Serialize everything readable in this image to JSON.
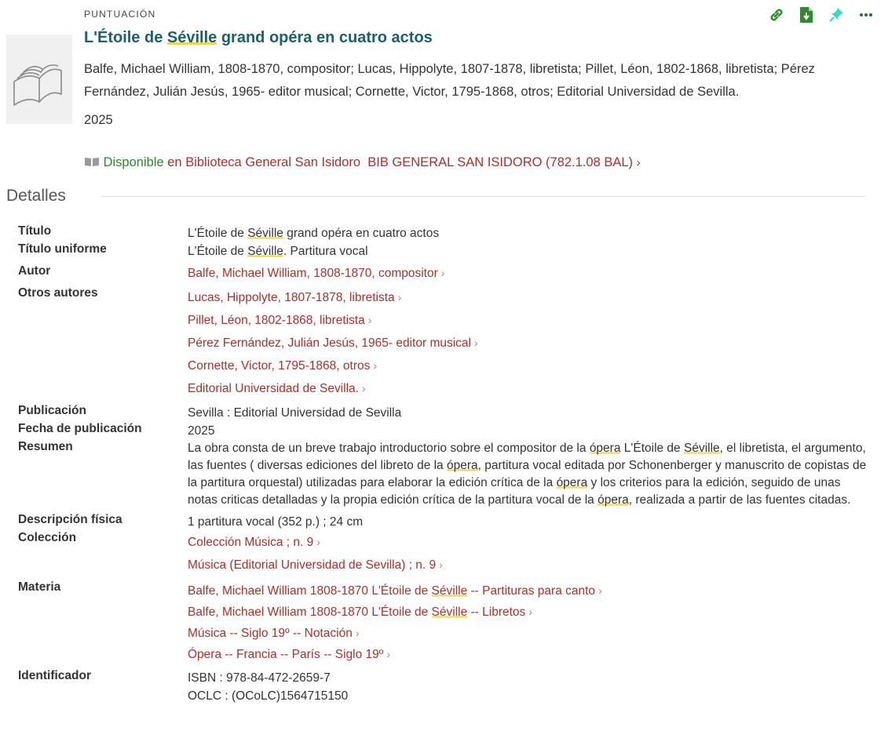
{
  "record": {
    "type": "PUNTUACIÓN",
    "title_pre": "L'Étoile de ",
    "title_hl": "Séville",
    "title_post": " grand opéra en cuatro actos",
    "authors_line": "Balfe, Michael William, 1808-1870, compositor; Lucas, Hippolyte, 1807-1878, libretista; Pillet, Léon, 1802-1868, libretista; Pérez Fernández, Julián Jesús, 1965- editor musical; Cornette, Victor, 1795-1868, otros; Editorial Universidad de Sevilla.",
    "year": "2025",
    "availability": {
      "status": "Disponible",
      "en": "en",
      "library": "Biblioteca General San Isidoro",
      "shelf": "BIB GENERAL SAN ISIDORO (782.1.08 BAL)"
    }
  },
  "actions": [
    "link-icon",
    "citation-export-icon",
    "pin-icon",
    "more-icon"
  ],
  "details": {
    "heading": "Detalles",
    "labels": {
      "titulo": "Título",
      "titulo_uniforme": "Título uniforme",
      "autor": "Autor",
      "otros_autores": "Otros autores",
      "publicacion": "Publicación",
      "fecha": "Fecha de publicación",
      "resumen": "Resumen",
      "descripcion": "Descripción física",
      "coleccion": "Colección",
      "materia": "Materia",
      "identificador": "Identificador"
    },
    "titulo": {
      "pre": "L'Étoile de ",
      "hl": "Séville",
      "post": " grand opéra en cuatro actos"
    },
    "titulo_uniforme": {
      "pre": "L'Étoile de ",
      "hl": "Séville",
      "post": ". Partitura vocal"
    },
    "autor": "Balfe, Michael William, 1808-1870, compositor",
    "otros_autores": [
      "Lucas, Hippolyte, 1807-1878, libretista",
      "Pillet, Léon, 1802-1868, libretista",
      "Pérez Fernández, Julián Jesús, 1965- editor musical",
      "Cornette, Victor, 1795-1868, otros",
      "Editorial Universidad de Sevilla."
    ],
    "publicacion": "Sevilla : Editorial Universidad de Sevilla",
    "fecha": "2025",
    "resumen": {
      "p1": "La obra consta de un breve trabajo introductorio sobre el compositor de la ",
      "p2": "ópera",
      "p3": " L'Étoile de ",
      "p4": "Séville",
      "p5": ", el libretista, el argumento, las fuentes ( diversas ediciones del libreto de la ",
      "p6": "ópera",
      "p7": ", partitura vocal editada por Schonenberger y manuscrito de copistas de la partitura orquestal) utilizadas para elaborar la edición crítica de la ",
      "p8": "ópera",
      "p9": " y los criterios para la edición, seguido de unas notas criticas detalladas y la propia edición crítica de la partitura vocal de la ",
      "p10": "ópera",
      "p11": ", realizada a partir de las fuentes citadas."
    },
    "descripcion": "1 partitura vocal (352 p.) ; 24 cm",
    "coleccion": [
      "Colección Música ; n. 9",
      "Música (Editorial Universidad de Sevilla) ; n. 9"
    ],
    "materia": {
      "m1_pre": "Balfe, Michael William 1808-1870 L'Étoile de ",
      "m1_hl": "Séville",
      "m1_post": " -- Partituras para canto",
      "m2_pre": "Balfe, Michael William 1808-1870 L'Étoile de ",
      "m2_hl": "Séville",
      "m2_post": " -- Libretos",
      "m3": "Música -- Siglo 19º -- Notación",
      "m4": "Ópera -- Francia -- París -- Siglo 19º"
    },
    "identificador": [
      "ISBN : 978-84-472-2659-7",
      "OCLC : (OCoLC)1564715150"
    ]
  },
  "colors": {
    "title": "#1d5f6c",
    "link": "#a8322a",
    "available": "#2a8a2a",
    "highlight": "#f5d24a"
  }
}
